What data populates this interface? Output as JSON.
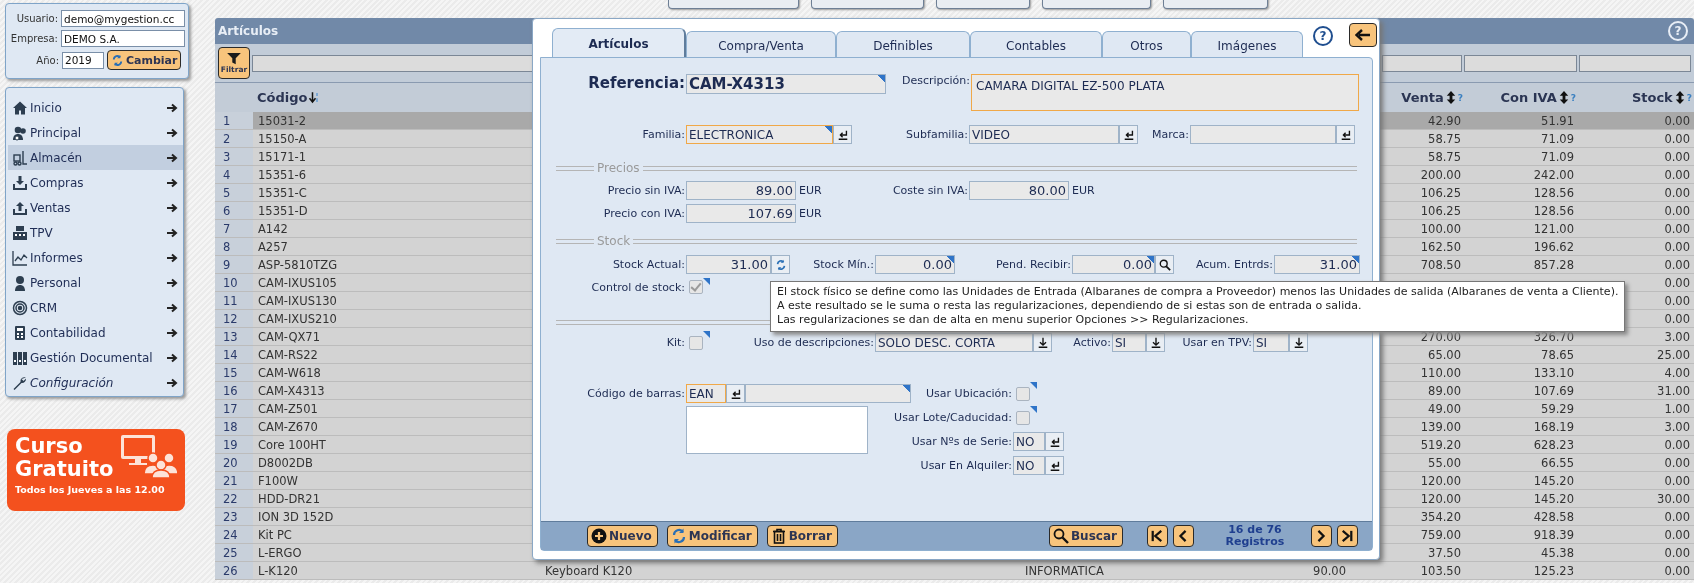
{
  "session": {
    "fields": [
      {
        "label": "Usuario:",
        "value": "demo@mygestion.cc"
      },
      {
        "label": "Empresa:",
        "value": "DEMO S.A."
      },
      {
        "label": "Año:",
        "value": "2019"
      }
    ],
    "button": "Cambiar"
  },
  "menu": [
    {
      "label": "Inicio",
      "selected": false
    },
    {
      "label": "Principal",
      "selected": false
    },
    {
      "label": "Almacén",
      "selected": true
    },
    {
      "label": "Compras",
      "selected": false
    },
    {
      "label": "Ventas",
      "selected": false
    },
    {
      "label": "TPV",
      "selected": false
    },
    {
      "label": "Informes",
      "selected": false
    },
    {
      "label": "Personal",
      "selected": false
    },
    {
      "label": "CRM",
      "selected": false
    },
    {
      "label": "Contabilidad",
      "selected": false
    },
    {
      "label": "Gestión Documental",
      "selected": false
    },
    {
      "label": "Configuración",
      "selected": false
    }
  ],
  "banner": {
    "lines": [
      "Curso",
      "Gratuito"
    ],
    "subtitle": "Todos los Jueves a las 12.00"
  },
  "panel": {
    "title": "Artículos",
    "help": "?",
    "filter_button": "Filtrar"
  },
  "table": {
    "columns": [
      {
        "label": "Código"
      },
      {
        "label": "Venta",
        "hint": "?"
      },
      {
        "label": "Con IVA",
        "hint": "?"
      },
      {
        "label": "Stock",
        "hint": "?"
      }
    ],
    "rows": [
      {
        "num": "1",
        "codigo": "15031-2",
        "venta": "42.90",
        "con_iva": "51.91",
        "stock": "0.00",
        "selected": true
      },
      {
        "num": "2",
        "codigo": "15150-A",
        "venta": "58.75",
        "con_iva": "71.09",
        "stock": "0.00",
        "selected": false
      },
      {
        "num": "3",
        "codigo": "15171-1",
        "venta": "58.75",
        "con_iva": "71.09",
        "stock": "0.00",
        "selected": false
      },
      {
        "num": "4",
        "codigo": "15351-6",
        "venta": "200.00",
        "con_iva": "242.00",
        "stock": "0.00",
        "selected": false
      },
      {
        "num": "5",
        "codigo": "15351-C",
        "venta": "106.25",
        "con_iva": "128.56",
        "stock": "0.00",
        "selected": false
      },
      {
        "num": "6",
        "codigo": "15351-D",
        "venta": "106.25",
        "con_iva": "128.56",
        "stock": "0.00",
        "selected": false
      },
      {
        "num": "7",
        "codigo": "A142",
        "venta": "100.00",
        "con_iva": "121.00",
        "stock": "0.00",
        "selected": false
      },
      {
        "num": "8",
        "codigo": "A257",
        "venta": "162.50",
        "con_iva": "196.62",
        "stock": "0.00",
        "selected": false
      },
      {
        "num": "9",
        "codigo": "ASP-5810TZG",
        "venta": "708.50",
        "con_iva": "857.28",
        "stock": "0.00",
        "selected": false
      },
      {
        "num": "10",
        "codigo": "CAM-IXUS105",
        "stock": "0.00",
        "selected": false
      },
      {
        "num": "11",
        "codigo": "CAM-IXUS130",
        "stock": "0.00",
        "selected": false
      },
      {
        "num": "12",
        "codigo": "CAM-IXUS210",
        "stock": "0.00",
        "selected": false
      },
      {
        "num": "13",
        "codigo": "CAM-QX71",
        "venta": "270.00",
        "con_iva": "326.70",
        "stock": "3.00",
        "selected": false
      },
      {
        "num": "14",
        "codigo": "CAM-RS22",
        "venta": "65.00",
        "con_iva": "78.65",
        "stock": "25.00",
        "selected": false
      },
      {
        "num": "15",
        "codigo": "CAM-W618",
        "venta": "110.00",
        "con_iva": "133.10",
        "stock": "4.00",
        "selected": false
      },
      {
        "num": "16",
        "codigo": "CAM-X4313",
        "venta": "89.00",
        "con_iva": "107.69",
        "stock": "31.00",
        "selected": false
      },
      {
        "num": "17",
        "codigo": "CAM-Z501",
        "venta": "49.00",
        "con_iva": "59.29",
        "stock": "1.00",
        "selected": false
      },
      {
        "num": "18",
        "codigo": "CAM-Z670",
        "venta": "139.00",
        "con_iva": "168.19",
        "stock": "3.00",
        "selected": false
      },
      {
        "num": "19",
        "codigo": "Core 100HT",
        "venta": "519.20",
        "con_iva": "628.23",
        "stock": "0.00",
        "selected": false
      },
      {
        "num": "20",
        "codigo": "D8002DB",
        "venta": "55.00",
        "con_iva": "66.55",
        "stock": "0.00",
        "selected": false
      },
      {
        "num": "21",
        "codigo": "F100W",
        "venta": "120.00",
        "con_iva": "145.20",
        "stock": "0.00",
        "selected": false
      },
      {
        "num": "22",
        "codigo": "HDD-DR21",
        "venta": "120.00",
        "con_iva": "145.20",
        "stock": "30.00",
        "selected": false
      },
      {
        "num": "23",
        "codigo": "ION 3D 152D",
        "venta": "354.20",
        "con_iva": "428.58",
        "stock": "0.00",
        "selected": false
      },
      {
        "num": "24",
        "codigo": "Kit PC",
        "venta": "759.00",
        "con_iva": "918.39",
        "stock": "0.00",
        "selected": false
      },
      {
        "num": "25",
        "codigo": "L-ERGO",
        "venta": "37.50",
        "con_iva": "45.38",
        "stock": "0.00",
        "selected": false
      },
      {
        "num": "26",
        "codigo": "L-K120",
        "descripcion": "Keyboard K120",
        "familia": "INFORMATICA",
        "column_5": "90.00",
        "venta": "103.50",
        "con_iva": "125.23",
        "stock": "0.00",
        "selected": false
      }
    ]
  },
  "dialog": {
    "help": "?",
    "tabs": [
      {
        "label": "Artículos",
        "selected": true
      },
      {
        "label": "Compra/Venta",
        "selected": false
      },
      {
        "label": "Definibles",
        "selected": false
      },
      {
        "label": "Contables",
        "selected": false
      },
      {
        "label": "Otros",
        "selected": false
      },
      {
        "label": "Imágenes",
        "selected": false
      }
    ],
    "referencia": {
      "label": "Referencia:",
      "value": "CAM-X4313",
      "marked": true
    },
    "descripcion": {
      "label": "Descripción:",
      "value": "CAMARA DIGITAL EZ-500 PLATA",
      "highlighted": true
    },
    "familia": {
      "label": "Familia:",
      "value": "ELECTRONICA",
      "highlighted": true,
      "marked": true
    },
    "subfamilia": {
      "label": "Subfamilia:",
      "value": "VIDEO"
    },
    "marca": {
      "label": "Marca:"
    },
    "precios": {
      "title": "Precios",
      "precio_sin_iva": {
        "label": "Precio sin IVA:",
        "value": "89.00",
        "unit": "EUR"
      },
      "coste_sin_iva": {
        "label": "Coste sin IVA:",
        "value": "80.00",
        "unit": "EUR"
      },
      "precio_con_iva": {
        "label": "Precio con IVA:",
        "value": "107.69",
        "unit": "EUR"
      }
    },
    "stock": {
      "title": "Stock",
      "actual": {
        "label": "Stock Actual:",
        "value": "31.00"
      },
      "minimo": {
        "label": "Stock Mín.:",
        "value": "0.00",
        "marked": true
      },
      "pendiente": {
        "label": "Pend. Recibir:",
        "value": "0.00",
        "marked": true
      },
      "acumulado": {
        "label": "Acum. Entrds:",
        "value": "31.00",
        "marked": true
      },
      "control": {
        "label": "Control de stock:",
        "checked": true,
        "marked": true
      }
    },
    "kit": {
      "label": "Kit:",
      "checked": false,
      "marked": true
    },
    "uso_descripciones": {
      "label": "Uso de descripciones:",
      "value": "SOLO DESC. CORTA"
    },
    "activo": {
      "label": "Activo:",
      "value": "SI"
    },
    "usar_tpv": {
      "label": "Usar en TPV:",
      "value": "SI"
    },
    "codigo_barras": {
      "label": "Código de barras:",
      "value": "EAN",
      "marked": true
    },
    "options": [
      {
        "kind": "checkbox",
        "label": "Usar Ubicación:",
        "checked": false,
        "marked": true
      },
      {
        "kind": "checkbox",
        "label": "Usar Lote/Caducidad:",
        "checked": false,
        "marked": true
      },
      {
        "kind": "select",
        "label": "Usar Nºs de Serie:",
        "value": "NO",
        "marked": false
      },
      {
        "kind": "select",
        "label": "Usar En Alquiler:",
        "value": "NO",
        "marked": false
      }
    ],
    "actions": [
      "Nuevo",
      "Modificar",
      "Borrar"
    ],
    "search_button": "Buscar",
    "record_counter": [
      "16 de 76",
      "Registros"
    ],
    "tooltip": [
      "El stock físico se define como las Unidades de Entrada (Albaranes de compra a Proveedor) menos las Unidades de salida (Albaranes de venta a Cliente).",
      "A este resultado se le suma o resta las regularizaciones, dependiendo de si estas son de entrada o salida.",
      "Las regularizaciones se dan de alta en menu superior Opciones >> Regularizaciones."
    ]
  }
}
